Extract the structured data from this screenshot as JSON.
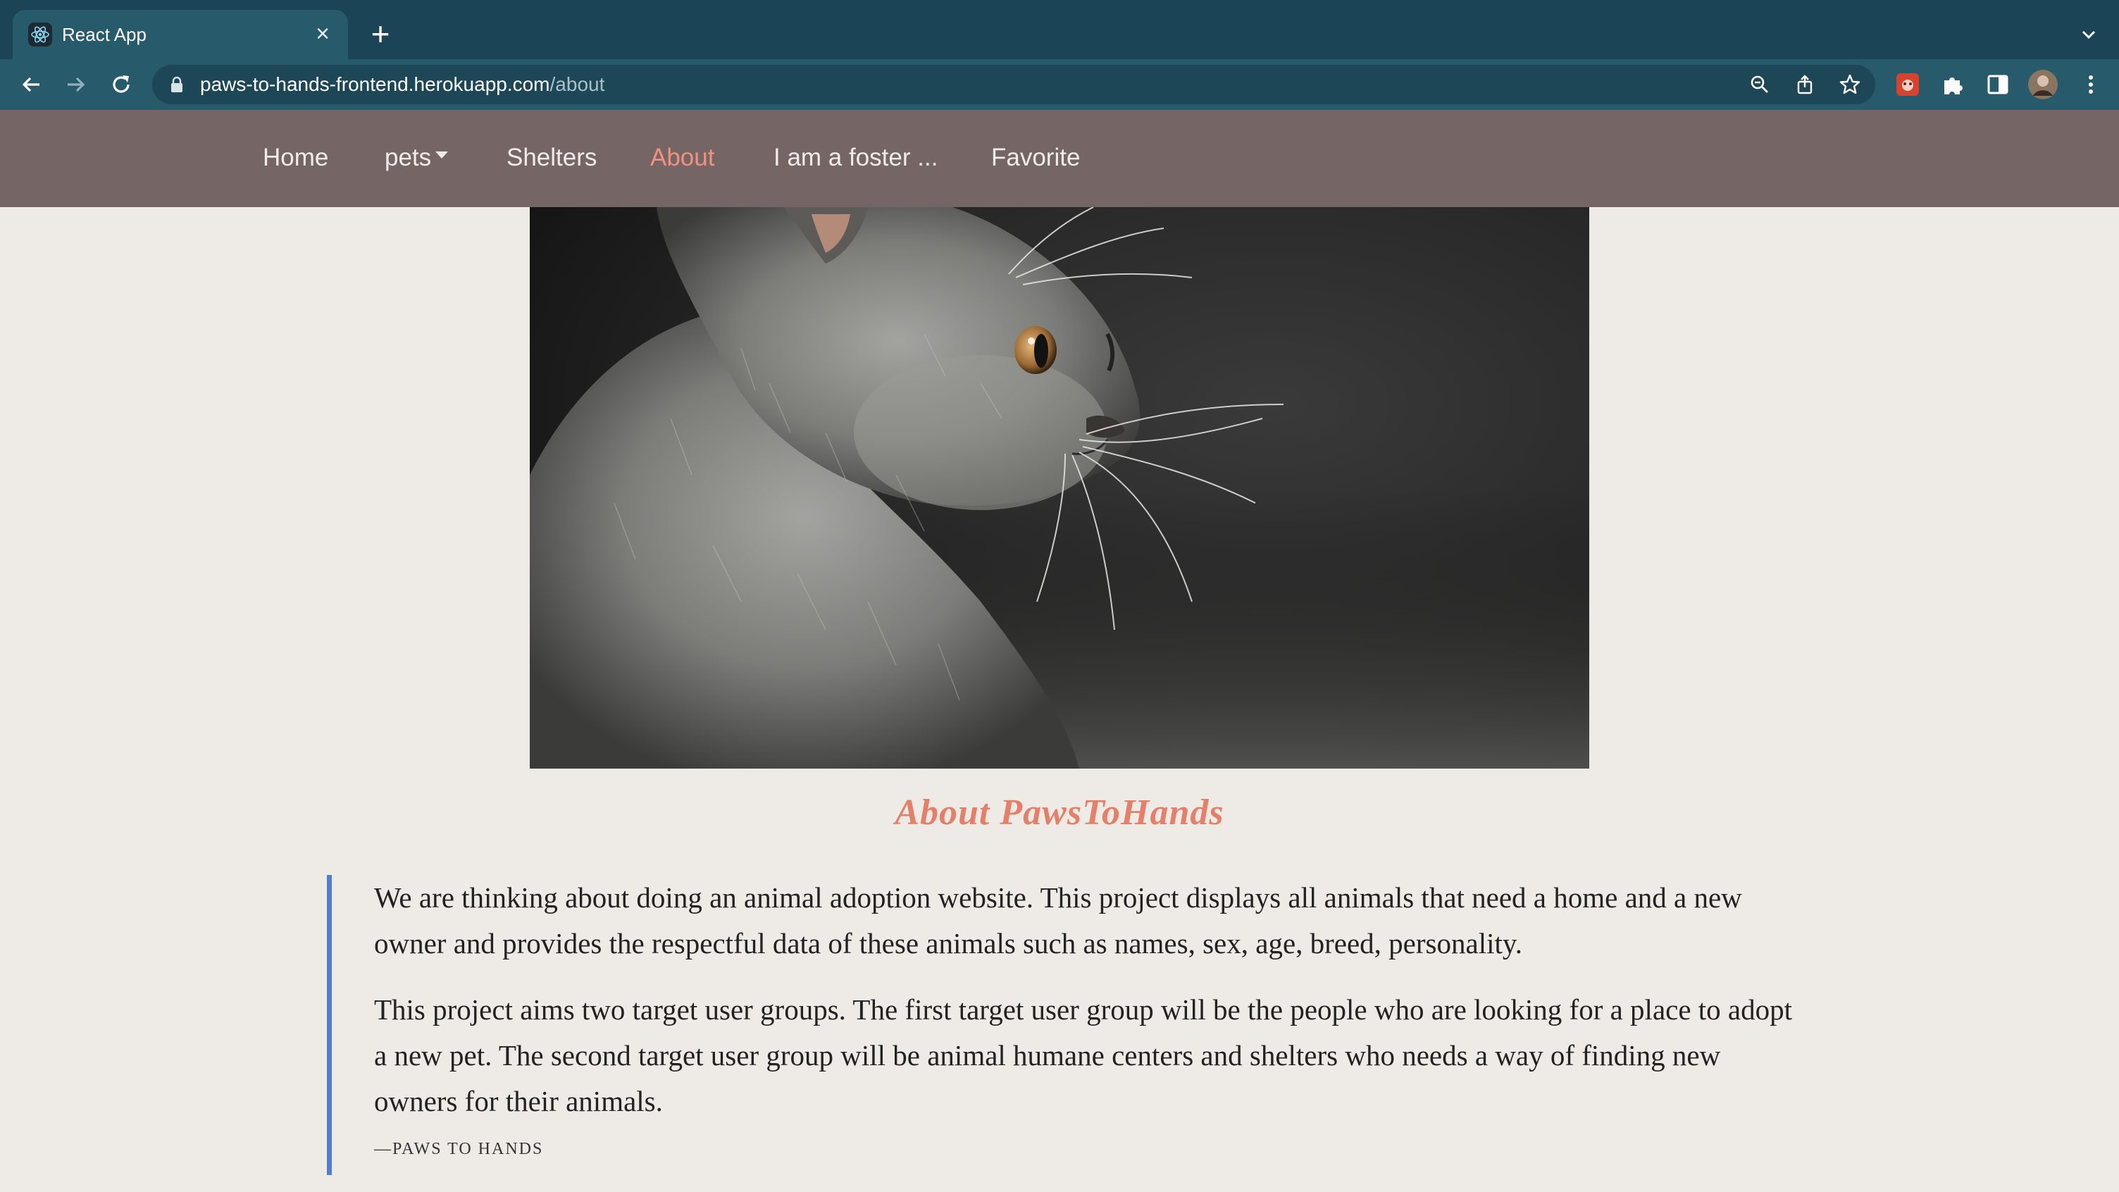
{
  "browser": {
    "tab_title": "React App",
    "tab_close": "×",
    "new_tab": "+",
    "url_host": "paws-to-hands-frontend.herokuapp.com",
    "url_path": "/about"
  },
  "nav": {
    "items": [
      {
        "label": "Home"
      },
      {
        "label": "pets"
      },
      {
        "label": "Shelters"
      },
      {
        "label": "About"
      },
      {
        "label": "I am a foster ..."
      },
      {
        "label": "Favorite"
      }
    ],
    "active": "About"
  },
  "hero": {
    "alt": "grey kitten portrait"
  },
  "about": {
    "title": "About PawsToHands",
    "paragraphs": [
      "We are thinking about doing an animal adoption website. This project displays all animals that need a home and a new owner and provides the respectful data of these animals such as names, sex, age, breed, personality.",
      "This project aims two target user groups. The first target user group will be the people who are looking for a place to adopt a new pet. The second target user group will be animal humane centers and shelters who needs a way of finding new owners for their animals."
    ],
    "cite": "—PAWS TO HANDS"
  },
  "colors": {
    "tabstrip": "#1b4456",
    "toolbar": "#275a6b",
    "nav_bg": "#766565",
    "accent": "#e4806a",
    "quote_border": "#4f7fd3",
    "page_bg": "#eeebe6"
  }
}
